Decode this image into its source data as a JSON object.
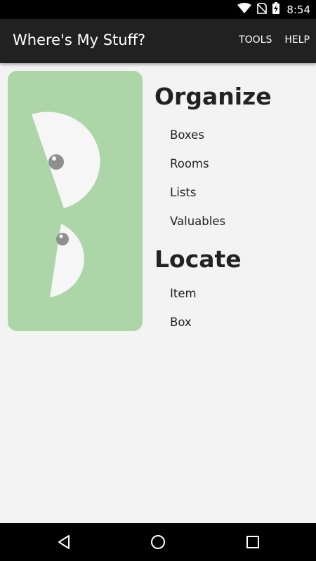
{
  "status_bar": {
    "time": "8:54",
    "icons": [
      "wifi-icon",
      "no-sim-icon",
      "battery-charging-icon"
    ]
  },
  "app_bar": {
    "title": "Where's My Stuff?",
    "actions": [
      "TOOLS",
      "HELP"
    ]
  },
  "illustration": {
    "background": "#acd6a7"
  },
  "menu": {
    "organize": {
      "title": "Organize",
      "items": [
        "Boxes",
        "Rooms",
        "Lists",
        "Valuables"
      ]
    },
    "locate": {
      "title": "Locate",
      "items": [
        "Item",
        "Box"
      ]
    }
  },
  "nav_bar": {
    "buttons": [
      "back-icon",
      "home-icon",
      "recents-icon"
    ]
  }
}
